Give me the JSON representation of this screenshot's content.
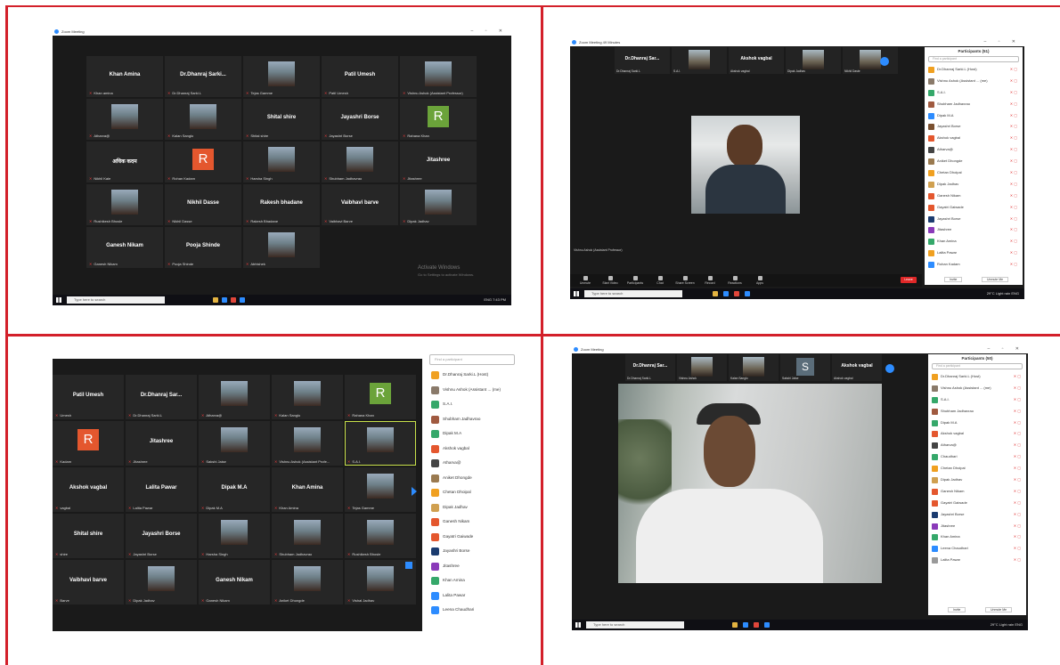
{
  "colors": {
    "divider": "#d3202a",
    "zoom_blue": "#2d8cff",
    "mic_muted": "#e03a3a",
    "active_outline": "#c8e04a"
  },
  "window": {
    "title": "Zoom Meeting",
    "title_tr": "Zoom Meeting 49 Minutes"
  },
  "taskbar": {
    "search_placeholder": "Type here to search",
    "tray_tl": "ENG 7:43 PM",
    "tray_tr": "29°C Light rain  ENG",
    "tray_br": "29°C Light rain  ENG"
  },
  "tl_gallery": {
    "tiles": [
      {
        "name": "Khan Amina",
        "label": "Khan amina",
        "photo": false
      },
      {
        "name": "Dr.Dhanraj Sarki...",
        "label": "Dr.Dhanraj Sarki.L",
        "photo": false
      },
      {
        "name": "",
        "label": "Tejas Gamme",
        "photo": true
      },
      {
        "name": "Patil Umesh",
        "label": "Patil Umesh",
        "photo": false
      },
      {
        "name": "",
        "label": "Vishnu Ashok (Assistant Professor)",
        "photo": true
      },
      {
        "name": "",
        "label": "Atharva@",
        "photo": true
      },
      {
        "name": "",
        "label": "Kalan Sanglo",
        "photo": true
      },
      {
        "name": "Shital shire",
        "label": "Shital shire",
        "photo": false
      },
      {
        "name": "Jayashri Borse",
        "label": "Jayashri Borse",
        "photo": false
      },
      {
        "name": "",
        "label": "Rahana Khan",
        "letter": "R",
        "color": "#6ba33a"
      },
      {
        "name": "अधिक कदम",
        "label": "Nikhil Kale",
        "photo": false
      },
      {
        "name": "",
        "label": "Rohan Kadam",
        "letter": "R",
        "color": "#e4572e"
      },
      {
        "name": "",
        "label": "Harsha Singh",
        "photo": true
      },
      {
        "name": "",
        "label": "Shubham Jadhavrao",
        "photo": true
      },
      {
        "name": "Jitashree",
        "label": "Jitashree",
        "photo": false
      },
      {
        "name": "",
        "label": "Rushikesh Bhosle",
        "photo": true
      },
      {
        "name": "Nikhil Dasse",
        "label": "Nikhil Dasse",
        "photo": false
      },
      {
        "name": "Rakesh bhadane",
        "label": "Rakesh Bhadane",
        "photo": false
      },
      {
        "name": "Vaibhavi barve",
        "label": "Vaibhavi Barve",
        "photo": false
      },
      {
        "name": "",
        "label": "Dipak Jadhav",
        "photo": true
      },
      {
        "name": "Ganesh Nikam",
        "label": "Ganesh Nikam",
        "photo": false
      },
      {
        "name": "Pooja Shinde",
        "label": "Pooja Shinde",
        "photo": false
      },
      {
        "name": "",
        "label": "Abhishek",
        "photo": true
      }
    ],
    "watermark_line1": "Activate Windows",
    "watermark_line2": "Go to Settings to activate Windows."
  },
  "tr_view": {
    "strip": [
      {
        "name": "Dr.Dhanraj Sar...",
        "label": "Dr.Dhanraj Sarki.L"
      },
      {
        "name": "",
        "label": "S.A.I."
      },
      {
        "name": "Akshok vagbal",
        "label": "Akshok vagbal"
      },
      {
        "name": "",
        "label": "Dipak Jadhav"
      },
      {
        "name": "",
        "label": "Nikhil Daste"
      }
    ],
    "speaker_caption": "Vishnu Ashok (Assistant Professor)",
    "toolbar": [
      "Unmute",
      "Start Video",
      "Participants",
      "Chat",
      "Share Screen",
      "Record",
      "Reactions",
      "Apps"
    ],
    "end": "Leave",
    "panel_title": "Participants (51)",
    "panel_search": "Find a participant",
    "panel_buttons": [
      "Invite",
      "Unmute Me"
    ]
  },
  "tr_participants": [
    {
      "name": "Dr.Dhanraj Sarki.L (Host)",
      "color": "#f0a020"
    },
    {
      "name": "Vishnu Ashok (Assistant ... (me)",
      "color": "#8a7a6a"
    },
    {
      "name": "S.A.I.",
      "color": "#35a86a"
    },
    {
      "name": "Shubham Jadhavrao",
      "color": "#a05a40"
    },
    {
      "name": "Dipak M.A",
      "color": "#2d8cff"
    },
    {
      "name": "Jayashri Borse",
      "color": "#7a5030"
    },
    {
      "name": "Akshok vagbal",
      "color": "#e4572e"
    },
    {
      "name": "Atharva@",
      "color": "#444"
    },
    {
      "name": "Aniket Dhongde",
      "color": "#9a7a50"
    },
    {
      "name": "Chetan Dhoipal",
      "color": "#f0a020"
    },
    {
      "name": "Dipak Jadhav",
      "color": "#d0a050"
    },
    {
      "name": "Ganesh Nikam",
      "color": "#e4572e"
    },
    {
      "name": "Gayatri Gaiwade",
      "color": "#e4572e"
    },
    {
      "name": "Jayashri Borse",
      "color": "#1b3b6f"
    },
    {
      "name": "Jitashree",
      "color": "#8a3ab9"
    },
    {
      "name": "Khan Amina",
      "color": "#35a86a"
    },
    {
      "name": "Lalita Pawar",
      "color": "#f0a020"
    },
    {
      "name": "Rohan Kadam",
      "color": "#2d8cff"
    }
  ],
  "bl_gallery": {
    "tiles": [
      {
        "name": "Patil Umesh",
        "label": "Umesh",
        "photo": false
      },
      {
        "name": "Dr.Dhanraj Sar...",
        "label": "Dr.Dhanraj Sarki.L",
        "photo": false
      },
      {
        "name": "",
        "label": "Atharva@",
        "photo": true
      },
      {
        "name": "",
        "label": "Kalan Sanglo",
        "photo": true
      },
      {
        "name": "",
        "label": "Rahana Khan",
        "letter": "R",
        "color": "#6ba33a"
      },
      {
        "name": "",
        "label": "Kadam",
        "letter": "R",
        "color": "#e4572e"
      },
      {
        "name": "Jitashree",
        "label": "Jitashree",
        "photo": false
      },
      {
        "name": "",
        "label": "Sakshi Jaise",
        "photo": true
      },
      {
        "name": "",
        "label": "Vishnu Ashok (Assistant Profe...",
        "photo": true
      },
      {
        "name": "",
        "label": "S.A.I.",
        "photo": true,
        "active": true
      },
      {
        "name": "Akshok vagbal",
        "label": "vagbal",
        "photo": false
      },
      {
        "name": "Lalita Pawar",
        "label": "Lalita Pawar",
        "photo": false
      },
      {
        "name": "Dipak M.A",
        "label": "Dipak M.A",
        "photo": false
      },
      {
        "name": "Khan Amina",
        "label": "Khan Amina",
        "photo": false
      },
      {
        "name": "",
        "label": "Tejas Gamme",
        "photo": true
      },
      {
        "name": "Shital shire",
        "label": "shire",
        "photo": false
      },
      {
        "name": "Jayashri Borse",
        "label": "Jayashri Borse",
        "photo": false
      },
      {
        "name": "",
        "label": "Harsha Singh",
        "photo": true
      },
      {
        "name": "",
        "label": "Shubham Jadhavrao",
        "photo": true
      },
      {
        "name": "",
        "label": "Rushikesh Bhosle",
        "photo": true
      },
      {
        "name": "Vaibhavi barve",
        "label": "Barve",
        "photo": false
      },
      {
        "name": "",
        "label": "Dipak Jadhav",
        "photo": true
      },
      {
        "name": "Ganesh Nikam",
        "label": "Ganesh Nikam",
        "photo": false
      },
      {
        "name": "",
        "label": "Aniket Dhongde",
        "photo": true
      },
      {
        "name": "",
        "label": "Vishal Jadhav",
        "photo": true
      }
    ]
  },
  "bl_list": [
    {
      "name": "Find a participant",
      "search": true
    },
    {
      "name": "Dr.Dhanraj Sarki.L (Host)",
      "color": "#f0a020"
    },
    {
      "name": "Vishnu Ashok (Assistant ... (me)",
      "color": "#8a7a6a"
    },
    {
      "name": "S.A.I.",
      "color": "#35a86a"
    },
    {
      "name": "Shubham Jadhavrao",
      "color": "#a05a40"
    },
    {
      "name": "Dipak M.A",
      "color": "#35a86a"
    },
    {
      "name": "Akshok vagbal",
      "color": "#e4572e"
    },
    {
      "name": "Atharva@",
      "color": "#444"
    },
    {
      "name": "Aniket Dhongde",
      "color": "#9a7a50"
    },
    {
      "name": "Chetan Dhoipal",
      "color": "#f0a020"
    },
    {
      "name": "Dipak Jadhav",
      "color": "#d0a050"
    },
    {
      "name": "Ganesh Nikam",
      "color": "#e4572e"
    },
    {
      "name": "Gayatri Gaiwade",
      "color": "#e4572e"
    },
    {
      "name": "Jayashri Borse",
      "color": "#1b3b6f"
    },
    {
      "name": "Jitashree",
      "color": "#8a3ab9"
    },
    {
      "name": "Khan Amina",
      "color": "#35a86a"
    },
    {
      "name": "Lalita Pawar",
      "color": "#2d8cff"
    },
    {
      "name": "Leena Chaudhari",
      "color": "#2d8cff"
    }
  ],
  "br_view": {
    "strip": [
      {
        "name": "Dr.Dhanraj Sar...",
        "label": "Dr.Dhanraj Sarki.L",
        "photo": false
      },
      {
        "name": "",
        "label": "Vishnu Ashok",
        "photo": true
      },
      {
        "name": "",
        "label": "Kalan Sanglo",
        "photo": true
      },
      {
        "name": "",
        "label": "Sakshi Jaise",
        "letter": "S"
      },
      {
        "name": "Akshok vagbal",
        "label": "Akshok vagbal",
        "photo": false
      }
    ],
    "panel_title": "Participants (50)",
    "panel_search": "Find a participant",
    "panel_buttons": [
      "Invite",
      "Unmute Me"
    ]
  },
  "br_participants": [
    {
      "name": "Dr.Dhanraj Sarki.L (Host)",
      "color": "#f0a020"
    },
    {
      "name": "Vishnu Ashok (Assistant ... (me)",
      "color": "#8a7a6a"
    },
    {
      "name": "S.A.I.",
      "color": "#35a86a"
    },
    {
      "name": "Shubham Jadhavrao",
      "color": "#a05a40"
    },
    {
      "name": "Dipak M.A",
      "color": "#35a86a"
    },
    {
      "name": "Akshok vagbal",
      "color": "#e4572e"
    },
    {
      "name": "Atharva@",
      "color": "#444"
    },
    {
      "name": "Chaudhari",
      "color": "#35a86a"
    },
    {
      "name": "Chetan Dhoipal",
      "color": "#f0a020"
    },
    {
      "name": "Dipak Jadhav",
      "color": "#d0a050"
    },
    {
      "name": "Ganesh Nikam",
      "color": "#e4572e"
    },
    {
      "name": "Gayatri Gaiwade",
      "color": "#e4572e"
    },
    {
      "name": "Jayashri Borse",
      "color": "#1b3b6f"
    },
    {
      "name": "Jitashree",
      "color": "#8a3ab9"
    },
    {
      "name": "Khan Amina",
      "color": "#35a86a"
    },
    {
      "name": "Leena Chaudhari",
      "color": "#2d8cff"
    },
    {
      "name": "Lalita Pawar",
      "color": "#9a9a9a"
    }
  ]
}
